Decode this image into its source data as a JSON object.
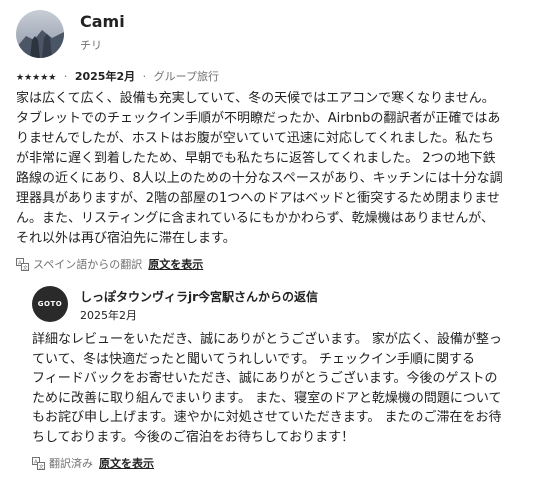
{
  "review": {
    "name": "Cami",
    "location": "チリ",
    "rating": 5,
    "stars": "★★★★★",
    "date": "2025年2月",
    "trip_type": "グループ旅行",
    "text": "家は広くて広く、設備も充実していて、冬の天候ではエアコンで寒くなりません。\nタブレットでのチェックイン手順が不明瞭だったか、Airbnbの翻訳者が正確ではあ\nりませんでしたが、ホストはお腹が空いていて迅速に対応してくれました。私たち\nが非常に遅く到着したため、早朝でも私たちに返答してくれました。 2つの地下鉄\n路線の近くにあり、8人以上のための十分なスペースがあり、キッチンには十分な調\n理器具がありますが、2階の部屋の1つへのドアはベッドと衝突するため閉まりませ\nん。また、リスティングに含まれているにもかかわらず、乾燥機はありませんが、\nそれ以外は再び宿泊先に滞在します。",
    "translation_note": "スペイン語からの翻訳",
    "show_original": "原文を表示"
  },
  "reply": {
    "host_logo": "GOTO",
    "title": "しっぽタウンヴィラjr今宮駅さんからの返信",
    "date": "2025年2月",
    "text": "詳細なレビューをいただき、誠にありがとうございます。 家が広く、設備が整っ\nていて、冬は快適だったと聞いてうれしいです。 チェックイン手順に関する\nフィードバックをお寄せいただき、誠にありがとうございます。今後のゲストの\nために改善に取り組んでまいります。 また、寝室のドアと乾燥機の問題について\nもお詫び申し上げます。速やかに対処させていただきます。 またのご滞在をお待\nちしております。今後のご宿泊をお待ちしております！",
    "translation_note": "翻訳済み",
    "show_original": "原文を表示"
  },
  "icons": {
    "translate": "translate-icon"
  }
}
